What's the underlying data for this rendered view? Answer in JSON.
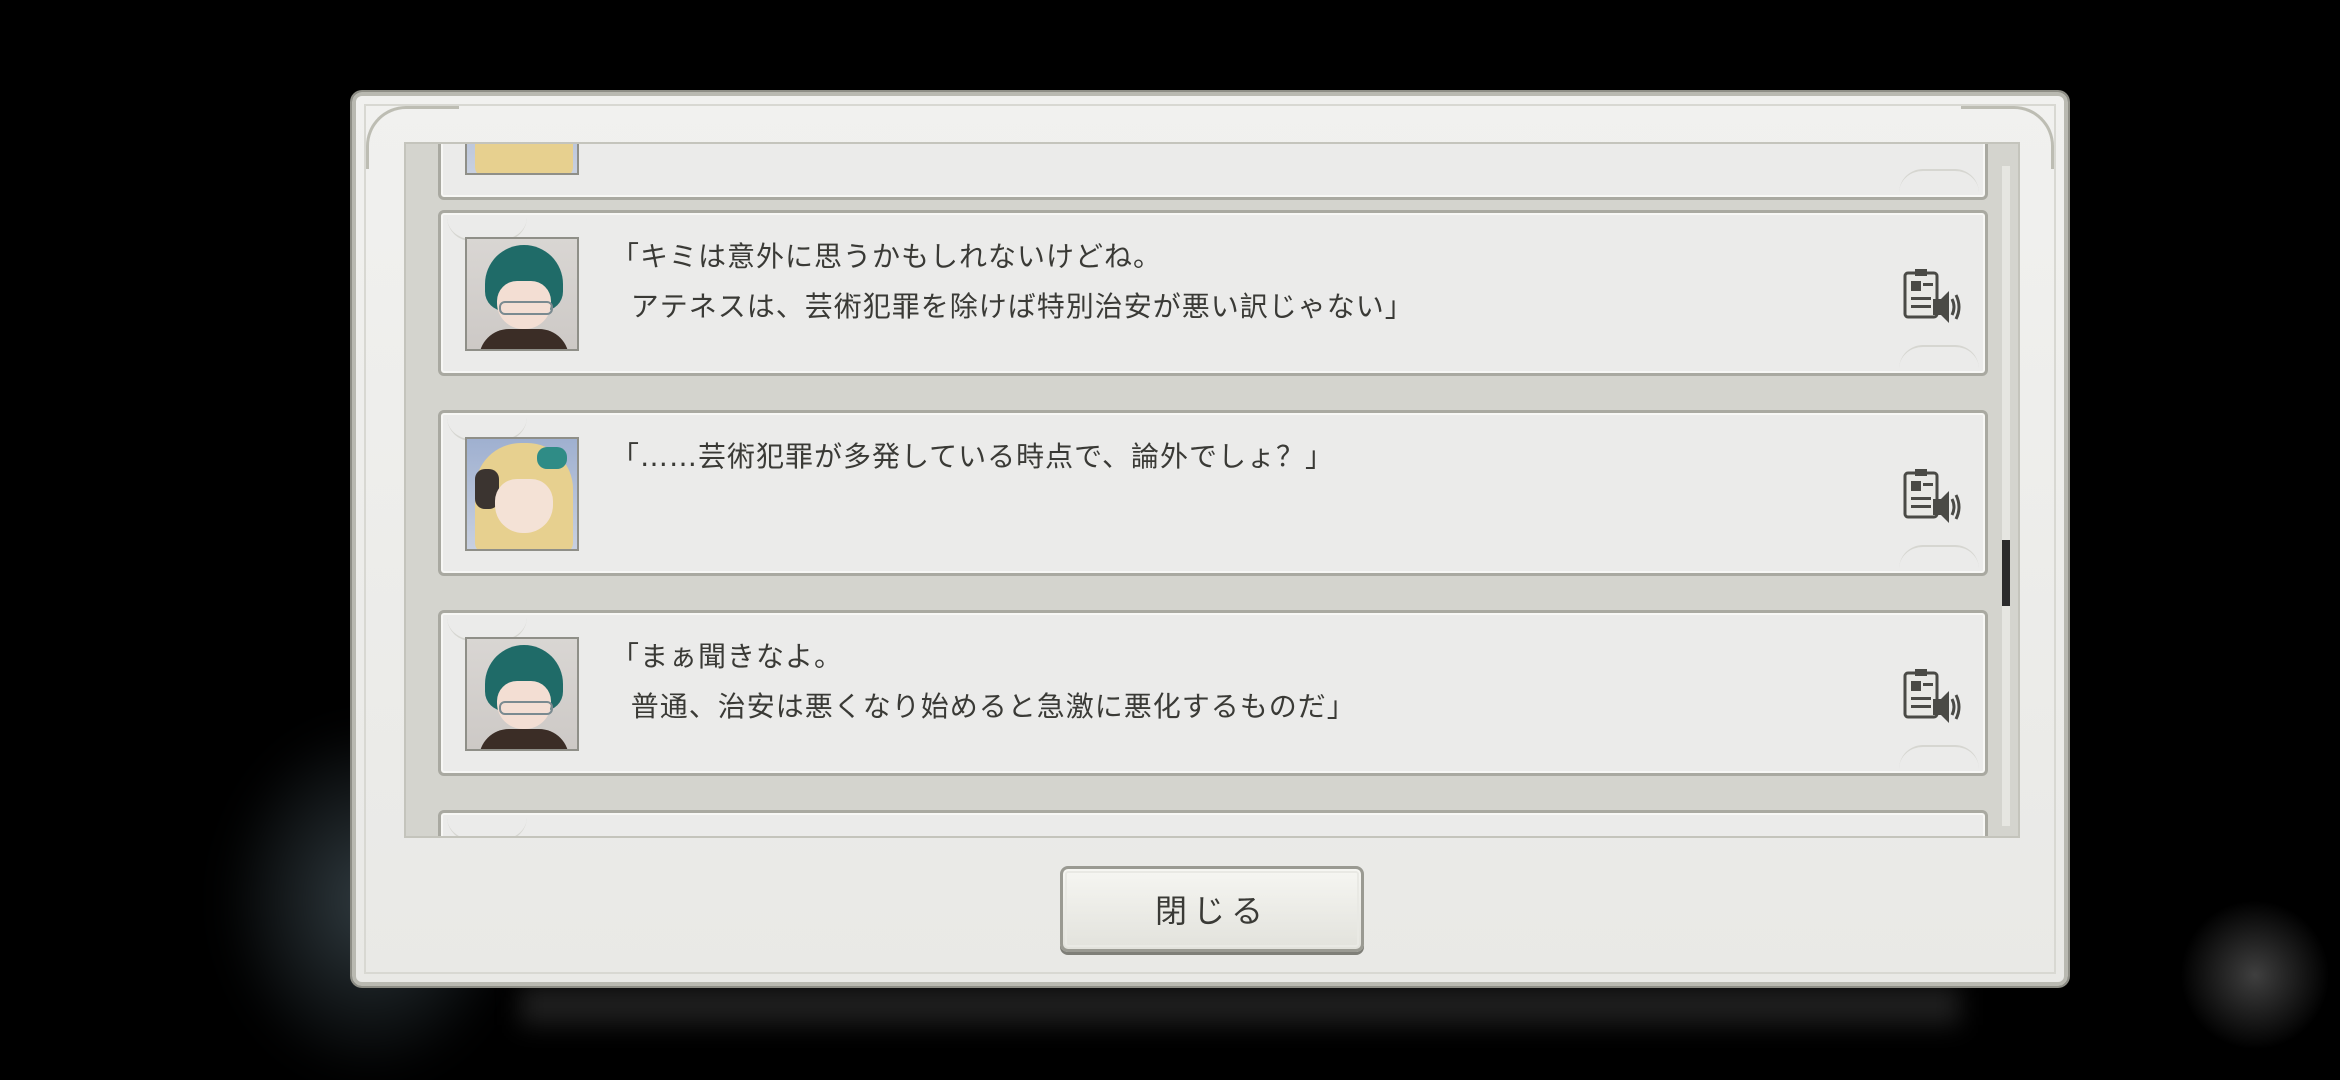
{
  "dialog": {
    "close_label": "閉じる"
  },
  "log_entries": [
    {
      "speaker_icon": "teal-hair-glasses-portrait",
      "line1": "「キミは意外に思うかもしれないけどね。",
      "line2": "  アテネスは、芸術犯罪を除けば特別治安が悪い訳じゃない」"
    },
    {
      "speaker_icon": "blonde-hair-portrait",
      "line1": "「……芸術犯罪が多発している時点で、論外でしょ？」",
      "line2": ""
    },
    {
      "speaker_icon": "teal-hair-glasses-portrait",
      "line1": "「まぁ聞きなよ。",
      "line2": "  普通、治安は悪くなり始めると急激に悪化するものだ」"
    }
  ],
  "icons": {
    "voice_replay": "voice-replay-icon"
  }
}
